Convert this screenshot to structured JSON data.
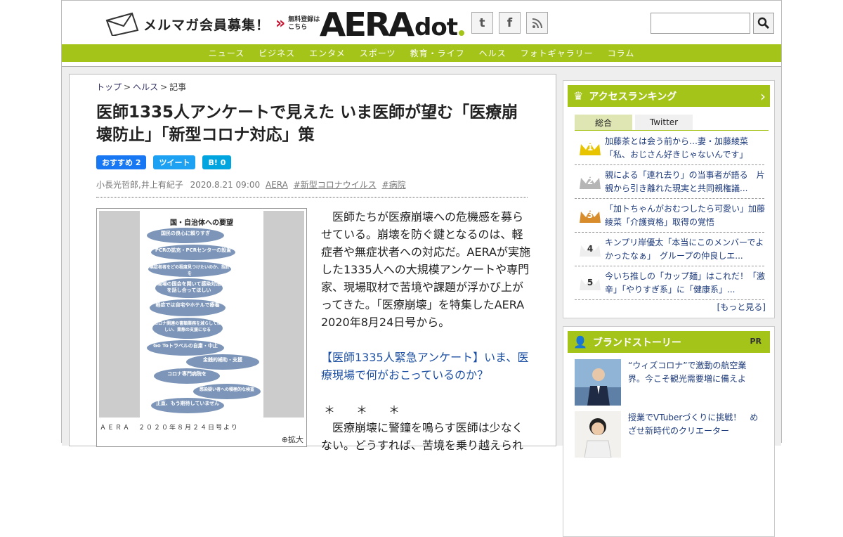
{
  "header": {
    "mailmag_text": "メルマガ会員募集！",
    "mailmag_small1": "無料登録は",
    "mailmag_small2": "こちら",
    "logo_aera": "AERA",
    "logo_dot": "dot",
    "social": [
      "t",
      "f",
      "rss"
    ]
  },
  "nav": [
    "ニュース",
    "ビジネス",
    "エンタメ",
    "スポーツ",
    "教育・ライフ",
    "ヘルス",
    "フォトギャラリー",
    "コラム"
  ],
  "breadcrumb": {
    "home": "トップ",
    "section": "ヘルス",
    "current": "記事"
  },
  "article": {
    "title": "医師1335人アンケートで見えた いま医師が望む「医療崩壊防止」「新型コロナ対応」策",
    "share_fb": "おすすめ 2",
    "share_tw": "ツイート",
    "share_hb": "B! 0",
    "authors": "小長光哲郎,井上有紀子",
    "date": "2020.8.21 09:00",
    "tags": [
      "AERA",
      "#新型コロナウイルス",
      "#病院"
    ],
    "figure_caption": "ＡＥＲＡ　２０２０年８月２４日号より",
    "figure_zoom": "拡大",
    "poster_title": "国・自治体への要望",
    "poster_items": [
      "国民の良心に頼りすぎ",
      "PCRの拡充・PCRセンターの設置",
      "無症者者をどの程度見つけたいのか、指針を",
      "現場の国会を開いて感染対策を話し合ってほしい",
      "軽症では自宅やホテルで療養",
      "コロナ関連の書類業務を減らしてほしい、業態の支援になる",
      "Go Toトラベルの自粛・中止",
      "金銭的補助・支援",
      "コロナ専門病院を",
      "感染疑い者への積極的な検査",
      "正直、もう期待していません"
    ],
    "body1": "医師たちが医療崩壊への危機感を募らせている。崩壊を防ぐ鍵となるのは、軽症者や無症状者への対応だ。AERAが実施した1335人への大規模アンケートや専門家、現場取材で苦境や課題が浮かび上がってきた。「医療崩壊」を特集したAERA 2020年8月24日号から。",
    "link": "【医師1335人緊急アンケート】いま、医療現場で何がおこっているのか？",
    "stars": "＊＊＊",
    "body2": "医療崩壊に警鐘を鳴らす医師は少なくない。どうすれば、苦境を乗り越えられ"
  },
  "ranking": {
    "title": "アクセスランキング",
    "tabs": [
      "総合",
      "Twitter"
    ],
    "items": [
      {
        "rank": "1",
        "text": "加藤茶とは会う前から…妻・加藤綾菜「私、おじさん好きじゃないんです」",
        "color": "#e8c400"
      },
      {
        "rank": "2",
        "text": "親による「連れ去り」の当事者が語る　片親から引き離れた現実と共同親権議...",
        "color": "#b5b5b5"
      },
      {
        "rank": "3",
        "text": "「加トちゃんがおむつしたら可愛い」加藤綾菜「介護資格」取得の覚悟",
        "color": "#d98c2b"
      },
      {
        "rank": "4",
        "text": "キンプリ岸優太「本当にこのメンバーでよかったなぁ」　グループの仲良しエ...",
        "color": "#eeeeee"
      },
      {
        "rank": "5",
        "text": "今いち推しの「カップ麺」はこれだ！「激辛」「やりすぎ系」に「健康系」...",
        "color": "#eeeeee"
      }
    ],
    "more": "[もっと見る]"
  },
  "brand": {
    "title": "ブランドストーリー",
    "pr": "PR",
    "items": [
      {
        "text": "“ウィズコロナ”で激動の航空業界。今こそ観光需要増に備えよ"
      },
      {
        "text": "授業でVTuberづくりに挑戦！　めざせ新時代のクリエーター"
      }
    ]
  },
  "colors": {
    "accent": "#a4c41a",
    "link": "#1d50a2"
  }
}
